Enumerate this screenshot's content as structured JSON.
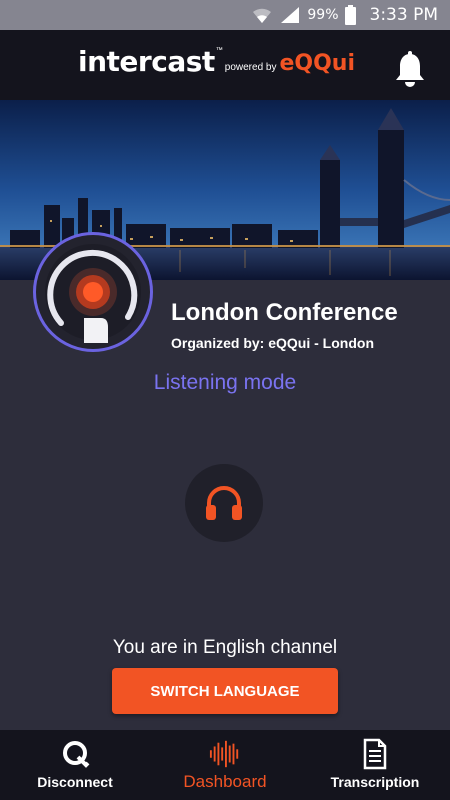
{
  "status_bar": {
    "battery": "99%",
    "time": "3:33 PM",
    "icons": [
      "wifi-icon",
      "signal-icon",
      "battery-icon"
    ]
  },
  "header": {
    "logo_main": "intercast",
    "logo_tm": "™",
    "logo_powered": "powered by",
    "logo_brand": "eQQui",
    "notification_icon": "bell-icon"
  },
  "event": {
    "title": "London Conference",
    "organizer": "Organized by: eQQui - London",
    "mode": "Listening mode"
  },
  "listen": {
    "icon": "headphones-icon"
  },
  "channel": {
    "text": "You are in English channel",
    "button_label": "SWITCH LANGUAGE"
  },
  "nav": {
    "items": [
      {
        "label": "Disconnect",
        "icon": "disconnect-q-icon"
      },
      {
        "label": "Dashboard",
        "icon": "audio-wave-icon",
        "active": true
      },
      {
        "label": "Transcription",
        "icon": "document-icon"
      }
    ]
  },
  "colors": {
    "accent": "#f25424",
    "mode_purple": "#7a73f0",
    "background": "#2d2d3b",
    "header_bg": "#14141d"
  }
}
